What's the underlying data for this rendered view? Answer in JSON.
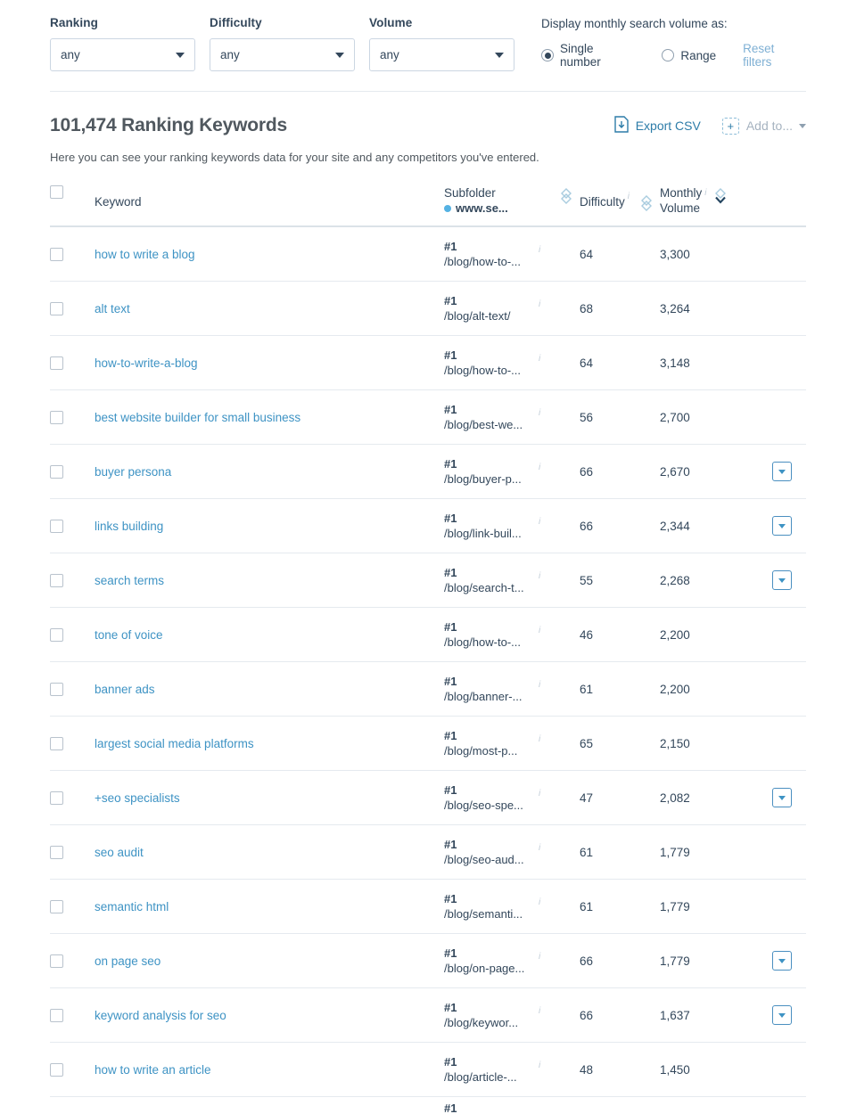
{
  "filters": {
    "ranking": {
      "label": "Ranking",
      "value": "any"
    },
    "difficulty": {
      "label": "Difficulty",
      "value": "any"
    },
    "volume": {
      "label": "Volume",
      "value": "any"
    },
    "display": {
      "title": "Display monthly search volume as:",
      "option_single": "Single number",
      "option_range": "Range",
      "selected": "Single number",
      "reset": "Reset filters"
    }
  },
  "header": {
    "title": "101,474 Ranking Keywords",
    "subtitle": "Here you can see your ranking keywords data for your site and any competitors you've entered.",
    "export_label": "Export CSV",
    "addto_label": "Add to...",
    "plus": "+"
  },
  "table": {
    "columns": {
      "keyword": "Keyword",
      "subfolder": "Subfolder",
      "subfolder_site": "www.se...",
      "difficulty": "Difficulty",
      "monthly_volume_l1": "Monthly",
      "monthly_volume_l2": "Volume",
      "info": "i"
    },
    "rows": [
      {
        "keyword": "how to write a blog",
        "rank": "#1",
        "path": "/blog/how-to-...",
        "difficulty": "64",
        "volume": "3,300",
        "menu": false
      },
      {
        "keyword": "alt text",
        "rank": "#1",
        "path": "/blog/alt-text/",
        "difficulty": "68",
        "volume": "3,264",
        "menu": false
      },
      {
        "keyword": "how-to-write-a-blog",
        "rank": "#1",
        "path": "/blog/how-to-...",
        "difficulty": "64",
        "volume": "3,148",
        "menu": false
      },
      {
        "keyword": "best website builder for small business",
        "rank": "#1",
        "path": "/blog/best-we...",
        "difficulty": "56",
        "volume": "2,700",
        "menu": false
      },
      {
        "keyword": "buyer persona",
        "rank": "#1",
        "path": "/blog/buyer-p...",
        "difficulty": "66",
        "volume": "2,670",
        "menu": true
      },
      {
        "keyword": "links building",
        "rank": "#1",
        "path": "/blog/link-buil...",
        "difficulty": "66",
        "volume": "2,344",
        "menu": true
      },
      {
        "keyword": "search terms",
        "rank": "#1",
        "path": "/blog/search-t...",
        "difficulty": "55",
        "volume": "2,268",
        "menu": true
      },
      {
        "keyword": "tone of voice",
        "rank": "#1",
        "path": "/blog/how-to-...",
        "difficulty": "46",
        "volume": "2,200",
        "menu": false
      },
      {
        "keyword": "banner ads",
        "rank": "#1",
        "path": "/blog/banner-...",
        "difficulty": "61",
        "volume": "2,200",
        "menu": false
      },
      {
        "keyword": "largest social media platforms",
        "rank": "#1",
        "path": "/blog/most-p...",
        "difficulty": "65",
        "volume": "2,150",
        "menu": false
      },
      {
        "keyword": "+seo specialists",
        "rank": "#1",
        "path": "/blog/seo-spe...",
        "difficulty": "47",
        "volume": "2,082",
        "menu": true
      },
      {
        "keyword": "seo audit",
        "rank": "#1",
        "path": "/blog/seo-aud...",
        "difficulty": "61",
        "volume": "1,779",
        "menu": false
      },
      {
        "keyword": "semantic html",
        "rank": "#1",
        "path": "/blog/semanti...",
        "difficulty": "61",
        "volume": "1,779",
        "menu": false
      },
      {
        "keyword": "on page seo",
        "rank": "#1",
        "path": "/blog/on-page...",
        "difficulty": "66",
        "volume": "1,779",
        "menu": true
      },
      {
        "keyword": "keyword analysis for seo",
        "rank": "#1",
        "path": "/blog/keywor...",
        "difficulty": "66",
        "volume": "1,637",
        "menu": true
      },
      {
        "keyword": "how to write an article",
        "rank": "#1",
        "path": "/blog/article-...",
        "difficulty": "48",
        "volume": "1,450",
        "menu": false
      }
    ],
    "partial_row": {
      "rank": "#1"
    }
  },
  "colors": {
    "link": "#3e93c4",
    "accent": "#2d7ca8",
    "dot": "#55b2e3",
    "text": "#33475b",
    "border": "#e5eaef"
  }
}
